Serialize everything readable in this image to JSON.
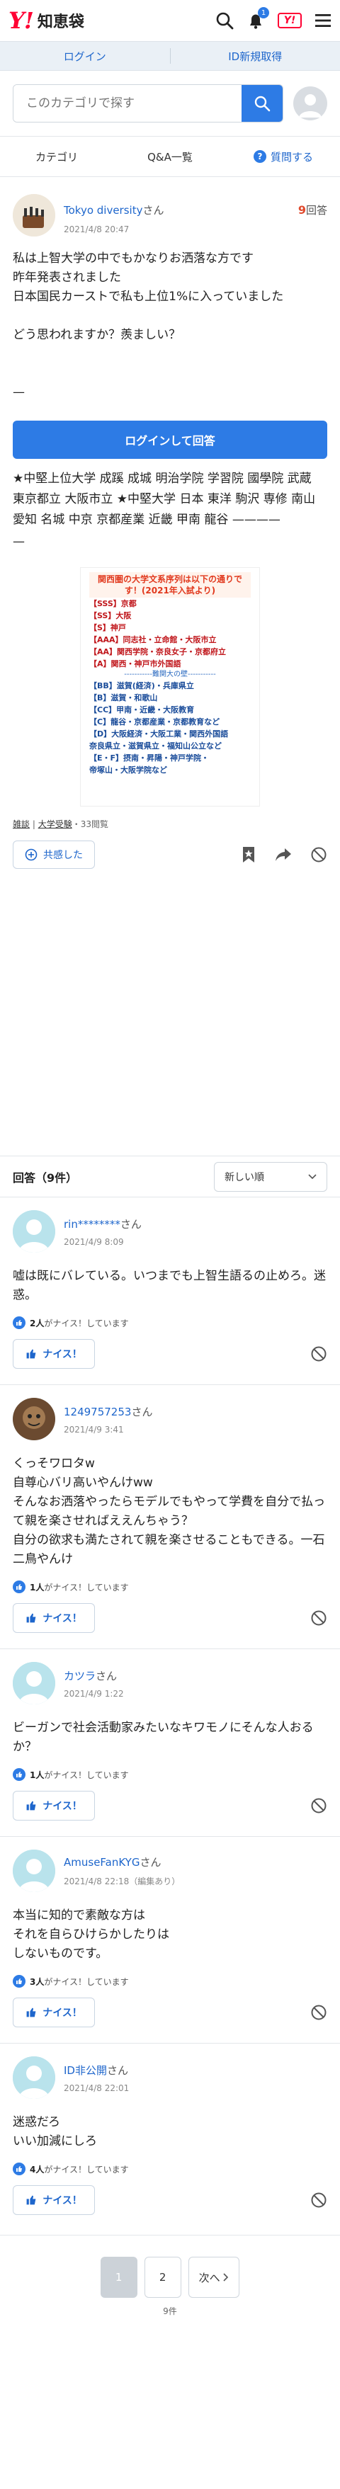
{
  "header": {
    "logo_mark": "Y!",
    "logo_text": "知恵袋",
    "notification_count": "1",
    "yj_label": "Y!"
  },
  "auth": {
    "login": "ログイン",
    "register": "ID新規取得"
  },
  "search": {
    "placeholder": "このカテゴリで探す"
  },
  "nav": {
    "category": "カテゴリ",
    "qa_list": "Q&A一覧",
    "ask": "質問する"
  },
  "question": {
    "user": "Tokyo diversity",
    "user_suffix": "さん",
    "date": "2021/4/8 20:47",
    "answer_count": "9",
    "answer_count_suffix": "回答",
    "body": "私は上智大学の中でもかなりお洒落な方です\n昨年発表されました\n日本国民カーストで私も上位1%に入っていました\n\nどう思われますか？羨ましい？\n\n\n—",
    "login_to_answer": "ログインして回答",
    "continued": "★中堅上位大学 成蹊 成城 明治学院 学習院 國學院 武蔵 東京都立 大阪市立 ★中堅大学 日本 東洋 駒沢 専修 南山 愛知 名城 中京 京都産業 近畿 甲南 龍谷 ————",
    "continued2": "—",
    "tags_cat1": "雑談",
    "tags_cat2": "大学受験",
    "views": "・33閲覧",
    "share": "共感した"
  },
  "rank_image": {
    "title": "関西圏の大学文系序列は以下の通りです！(2021年入試より)",
    "lines": [
      {
        "text": "【SSS】京都",
        "color": "#c0161b"
      },
      {
        "text": "【SS】大阪",
        "color": "#c0161b"
      },
      {
        "text": "【S】神戸",
        "color": "#c0161b"
      },
      {
        "text": "【AAA】同志社・立命館・大阪市立",
        "color": "#c0161b"
      },
      {
        "text": "【AA】関西学院・奈良女子・京都府立",
        "color": "#c0161b"
      },
      {
        "text": "【A】関西・神戸市外国語",
        "color": "#c0161b"
      },
      {
        "text": "-----------難関大の壁-----------",
        "color": "#2a6ac0"
      },
      {
        "text": "【BB】滋賀(経済)・兵庫県立",
        "color": "#1a4c9a"
      },
      {
        "text": "【B】滋賀・和歌山",
        "color": "#1a4c9a"
      },
      {
        "text": "【CC】甲南・近畿・大阪教育",
        "color": "#1a4c9a"
      },
      {
        "text": "【C】龍谷・京都産業・京都教育など",
        "color": "#1a4c9a"
      },
      {
        "text": "【D】大阪経済・大阪工業・関西外国語",
        "color": "#1a4c9a"
      },
      {
        "text": "奈良県立・滋賀県立・福知山公立など",
        "color": "#1a4c9a"
      },
      {
        "text": "【E・F】摂南・昇陽・神戸学院・",
        "color": "#1a4c9a"
      },
      {
        "text": "帝塚山・大阪学院など",
        "color": "#1a4c9a"
      }
    ]
  },
  "answers_header": {
    "title": "回答（9件）",
    "sort": "新しい順"
  },
  "answers": [
    {
      "user": "rin********",
      "user_suffix": "さん",
      "date": "2021/4/9 8:09",
      "body": "嘘は既にバレている。いつまでも上智生語るの止めろ。迷惑。",
      "nice_count": "2人",
      "nice_text": "がナイス！しています",
      "nice_btn": "ナイス！",
      "avatar": "#b9e3ec"
    },
    {
      "user": "1249757253",
      "user_suffix": "さん",
      "date": "2021/4/9 3:41",
      "body": "くっそワロタw\n自尊心バリ高いやんけww\nそんなお洒落やったらモデルでもやって学費を自分で払って親を楽させればええんちゃう？\n自分の欲求も満たされて親を楽させることもできる。一石二鳥やんけ",
      "nice_count": "1人",
      "nice_text": "がナイス！しています",
      "nice_btn": "ナイス！",
      "avatar": "#7a5a3c"
    },
    {
      "user": "カツラ",
      "user_suffix": "さん",
      "date": "2021/4/9 1:22",
      "body": "ビーガンで社会活動家みたいなキワモノにそんな人おるか？",
      "nice_count": "1人",
      "nice_text": "がナイス！しています",
      "nice_btn": "ナイス！",
      "avatar": "#b9e3ec"
    },
    {
      "user": "AmuseFanKYG",
      "user_suffix": "さん",
      "date": "2021/4/8 22:18（編集あり）",
      "body": "本当に知的で素敵な方は\nそれを自らひけらかしたりは\nしないものです。",
      "nice_count": "3人",
      "nice_text": "がナイス！しています",
      "nice_btn": "ナイス！",
      "avatar": "#b9e3ec"
    },
    {
      "user": "ID非公開",
      "user_suffix": "さん",
      "date": "2021/4/8 22:01",
      "body": "迷惑だろ\nいい加減にしろ",
      "nice_count": "4人",
      "nice_text": "がナイス！しています",
      "nice_btn": "ナイス！",
      "avatar": "#b9e3ec"
    }
  ],
  "pagination": {
    "pages": [
      "1",
      "2"
    ],
    "next": "次へ",
    "total": "9件"
  },
  "colors": {
    "brand": "#ff0033",
    "accent": "#2d7be5",
    "link": "#1e66cc",
    "count": "#e0492c"
  }
}
